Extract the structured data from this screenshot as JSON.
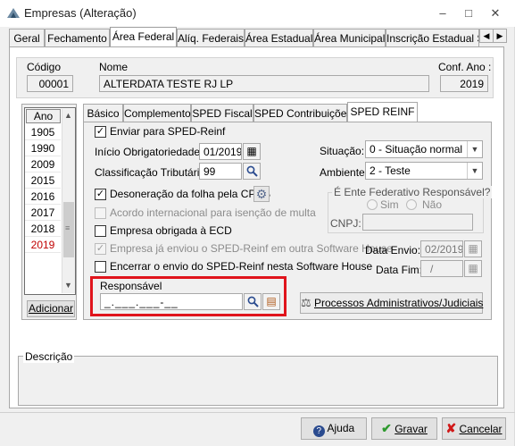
{
  "window": {
    "title": "Empresas (Alteração)",
    "controls": {
      "minimize": "–",
      "maximize": "□",
      "close": "✕"
    }
  },
  "top_tabs": [
    "Geral",
    "Fechamento",
    "Área Federal",
    "Alíq. Federais",
    "Área Estadual",
    "Área Municipal",
    "Inscrição Estadual S"
  ],
  "top_tabs_active": "Área Federal",
  "header": {
    "codigo_label": "Código",
    "codigo_value": "00001",
    "nome_label": "Nome",
    "nome_value": "ALTERDATA TESTE RJ LP",
    "conf_ano_label": "Conf. Ano :",
    "conf_ano_value": "2019"
  },
  "ano_list": {
    "header": "Ano",
    "years": [
      "1905",
      "1990",
      "2009",
      "2015",
      "2016",
      "2017",
      "2018",
      "2019"
    ],
    "selected": "2019",
    "add_button": "Adicionar"
  },
  "inner_tabs": [
    "Básico",
    "Complemento",
    "SPED Fiscal",
    "SPED Contribuições",
    "SPED REINF"
  ],
  "inner_tabs_active": "SPED REINF",
  "reinf": {
    "enviar_label": "Enviar para SPED-Reinf",
    "enviar_checked": true,
    "inicio_label": "Início Obrigatoriedade:",
    "inicio_value": "01/2019",
    "classificacao_label": "Classificação Tributária:",
    "classificacao_value": "99",
    "desoneracao_label": "Desoneração da folha pela CPRB",
    "desoneracao_checked": true,
    "acordo_label": "Acordo internacional para isenção de multa",
    "ecd_label": "Empresa obrigada à ECD",
    "ja_enviou_label": "Empresa já enviou o SPED-Reinf em outra Software House",
    "encerrar_label": "Encerrar o envio do SPED-Reinf nesta Software House",
    "situacao_label": "Situação:",
    "situacao_value": "0 - Situação normal",
    "ambiente_label": "Ambiente:",
    "ambiente_value": "2 - Teste",
    "ente_label": "É Ente Federativo Responsável?",
    "sim_label": "Sim",
    "nao_label": "Não",
    "cnpj_label": "CNPJ:",
    "cnpj_value": "",
    "data_envio_label": "Data Envio:",
    "data_envio_value": "02/2019",
    "data_fim_label": "Data Fim:",
    "data_fim_value": "/",
    "responsavel_label": "Responsável",
    "responsavel_value": "_.___.___-__",
    "processos_button": "Processos Administrativos/Judiciais"
  },
  "descricao_label": "Descrição",
  "footer": {
    "ajuda": "Ajuda",
    "gravar": "Gravar",
    "cancelar": "Cancelar"
  },
  "colors": {
    "highlight_border": "#e0141c",
    "selected_year": "#c00000"
  }
}
